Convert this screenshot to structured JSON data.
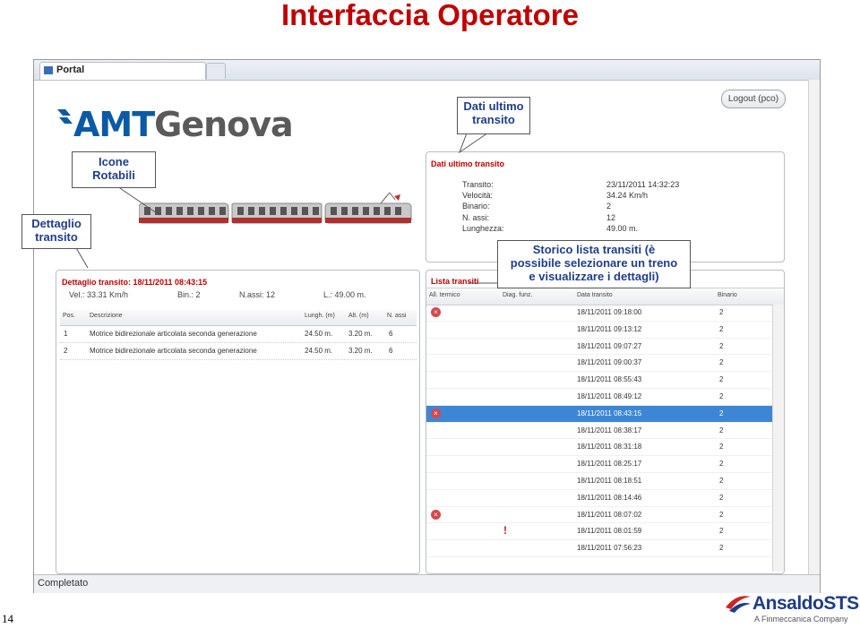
{
  "slide": {
    "title": "Interfaccia Operatore",
    "page_number": "14"
  },
  "browser": {
    "tab_label": "Portal",
    "status_text": "Completato"
  },
  "app": {
    "logo_amt": "AMT",
    "logo_genova": "Genova",
    "logout_label": "Logout (pco)"
  },
  "last_transit": {
    "title": "Dati ultimo transito",
    "fields": [
      {
        "label": "Transito:",
        "value": "23/11/2011 14:32:23"
      },
      {
        "label": "Velocità:",
        "value": "34.24 Km/h"
      },
      {
        "label": "Binario:",
        "value": "2"
      },
      {
        "label": "N. assi:",
        "value": "12"
      },
      {
        "label": "Lunghezza:",
        "value": "49.00 m."
      }
    ]
  },
  "detail": {
    "title": "Dettaglio transito: 18/11/2011 08:43:15",
    "vel": "Vel.: 33.31 Km/h",
    "bin": "Bin.: 2",
    "assi": "N.assi: 12",
    "len": "L.: 49.00 m.",
    "columns": [
      "Pos.",
      "Descrizione",
      "Lungh. (m)",
      "Alt. (m)",
      "N. assi"
    ],
    "rows": [
      {
        "pos": "1",
        "desc": "Motrice bidirezionale articolata seconda generazione",
        "lungh": "24.50 m.",
        "alt": "3.20 m.",
        "assi": "6"
      },
      {
        "pos": "2",
        "desc": "Motrice bidirezionale articolata seconda generazione",
        "lungh": "24.50 m.",
        "alt": "3.20 m.",
        "assi": "6"
      }
    ]
  },
  "transit_list": {
    "title": "Lista transiti",
    "columns": [
      "All. termico",
      "Diag. funz.",
      "Data transito",
      "Binario"
    ],
    "rows": [
      {
        "date": "18/11/2011 09:18:00",
        "binario": "2",
        "alarm": true,
        "selected": false,
        "warning": false
      },
      {
        "date": "18/11/2011 09:13:12",
        "binario": "2",
        "alarm": false,
        "selected": false,
        "warning": false
      },
      {
        "date": "18/11/2011 09:07:27",
        "binario": "2",
        "alarm": false,
        "selected": false,
        "warning": false
      },
      {
        "date": "18/11/2011 09:00:37",
        "binario": "2",
        "alarm": false,
        "selected": false,
        "warning": false
      },
      {
        "date": "18/11/2011 08:55:43",
        "binario": "2",
        "alarm": false,
        "selected": false,
        "warning": false
      },
      {
        "date": "18/11/2011 08:49:12",
        "binario": "2",
        "alarm": false,
        "selected": false,
        "warning": false
      },
      {
        "date": "18/11/2011 08:43:15",
        "binario": "2",
        "alarm": true,
        "selected": true,
        "warning": false
      },
      {
        "date": "18/11/2011 08:38:17",
        "binario": "2",
        "alarm": false,
        "selected": false,
        "warning": false
      },
      {
        "date": "18/11/2011 08:31:18",
        "binario": "2",
        "alarm": false,
        "selected": false,
        "warning": false
      },
      {
        "date": "18/11/2011 08:25:17",
        "binario": "2",
        "alarm": false,
        "selected": false,
        "warning": false
      },
      {
        "date": "18/11/2011 08:18:51",
        "binario": "2",
        "alarm": false,
        "selected": false,
        "warning": false
      },
      {
        "date": "18/11/2011 08:14:46",
        "binario": "2",
        "alarm": false,
        "selected": false,
        "warning": false
      },
      {
        "date": "18/11/2011 08:07:02",
        "binario": "2",
        "alarm": true,
        "selected": false,
        "warning": false
      },
      {
        "date": "18/11/2011 08:01:59",
        "binario": "2",
        "alarm": false,
        "selected": false,
        "warning": true
      },
      {
        "date": "18/11/2011 07:56:23",
        "binario": "2",
        "alarm": false,
        "selected": false,
        "warning": false
      }
    ]
  },
  "callouts": {
    "last_transit_line1": "Dati ultimo",
    "last_transit_line2": "transito",
    "icons_line1": "Icone",
    "icons_line2": "Rotabili",
    "detail_line1": "Dettaglio",
    "detail_line2": "transito",
    "history_line1": "Storico lista transiti (è",
    "history_line2": "possibile selezionare un treno",
    "history_line3": "e visualizzare i dettagli)"
  },
  "footer": {
    "company": "AnsaldoSTS",
    "subtitle": "A Finmeccanica Company"
  },
  "colors": {
    "title_red": "#c00000",
    "callout_blue": "#1f3d8c",
    "amt_blue": "#0b5aa7",
    "selection_blue": "#3d86d6",
    "alarm_red": "#d8474c"
  }
}
